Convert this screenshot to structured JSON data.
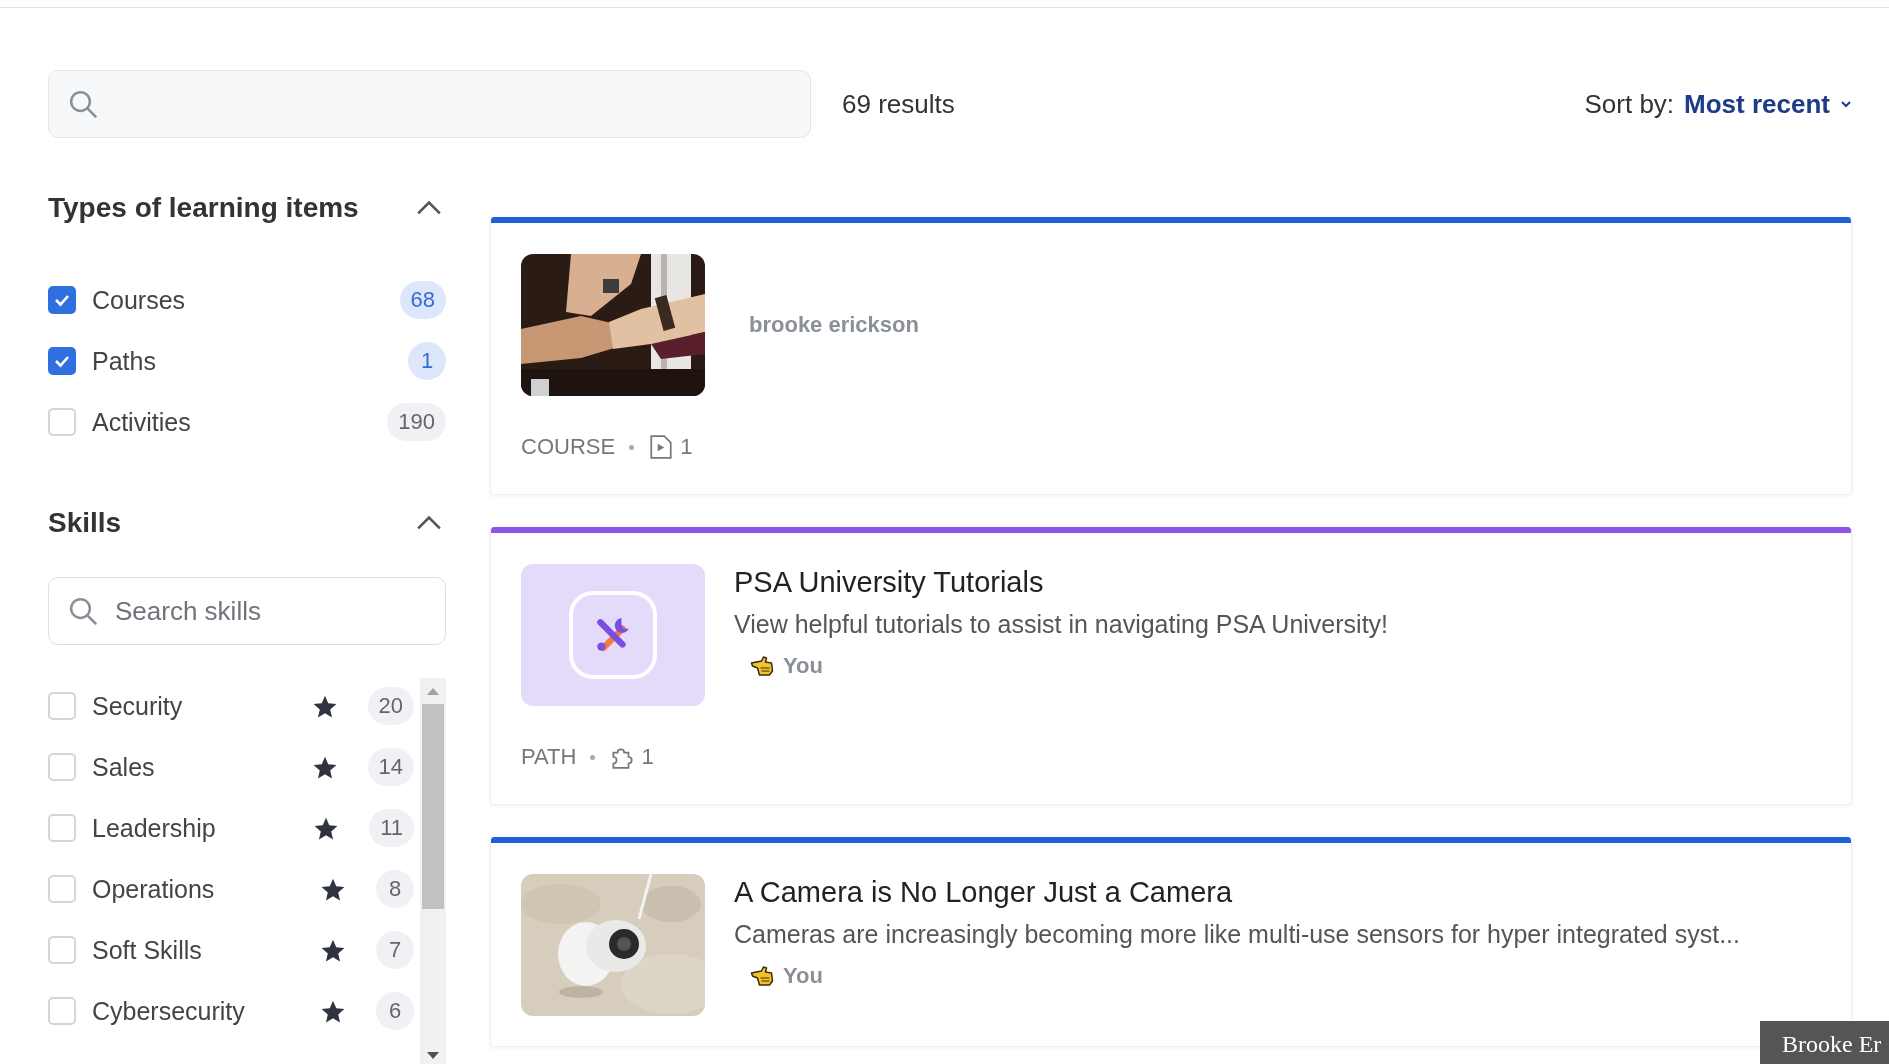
{
  "results_count": "69 results",
  "sort": {
    "label": "Sort by:",
    "value": "Most recent"
  },
  "filters": [
    {
      "title": "Types of learning items",
      "expanded": true,
      "items": [
        {
          "label": "Courses",
          "checked": true,
          "count": "68"
        },
        {
          "label": "Paths",
          "checked": true,
          "count": "1"
        },
        {
          "label": "Activities",
          "checked": false,
          "count": "190"
        }
      ]
    }
  ],
  "skills": {
    "title": "Skills",
    "expanded": true,
    "search": {
      "placeholder": "Search skills"
    },
    "items": [
      {
        "label": "Security",
        "checked": false,
        "count": "20"
      },
      {
        "label": "Sales",
        "checked": false,
        "count": "14"
      },
      {
        "label": "Leadership",
        "checked": false,
        "count": "11"
      },
      {
        "label": "Operations",
        "checked": false,
        "count": "8"
      },
      {
        "label": "Soft Skills",
        "checked": false,
        "count": "7"
      },
      {
        "label": "Cybersecurity",
        "checked": false,
        "count": "6"
      }
    ]
  },
  "cards": [
    {
      "color": "#1f5fd8",
      "author": "brooke erickson",
      "author_icon": false,
      "type": "COURSE",
      "type_icon": {
        "kind": "video"
      },
      "count": "1"
    },
    {
      "color": "#8c55e8",
      "thumbnail": {
        "kind": "icon"
      },
      "title": "PSA University Tutorials",
      "description": "View helpful tutorials to assist in navigating PSA University!",
      "author": "You",
      "author_icon": true,
      "type": "PATH",
      "type_icon": {
        "kind": "puzzle"
      },
      "count": "1"
    },
    {
      "color": "#1f5fd8",
      "title": "A Camera is No Longer Just a Camera",
      "description": "Cameras are increasingly becoming more like multi-use sensors for hyper integrated syst...",
      "author": "You",
      "author_icon": true
    }
  ],
  "tooltip": "Brooke Er"
}
